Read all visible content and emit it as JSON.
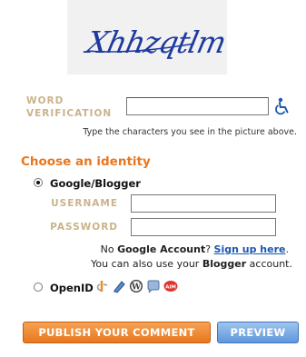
{
  "captcha": {
    "text": "Xhhzqtlm"
  },
  "word_verification": {
    "label": "WORD VERIFICATION",
    "hint": "Type the characters you see in the picture above.",
    "value": ""
  },
  "identity": {
    "title": "Choose an identity",
    "google": {
      "label": "Google/Blogger",
      "selected": true,
      "username_label": "USERNAME",
      "password_label": "PASSWORD",
      "username_value": "",
      "password_value": "",
      "no_account_prefix": "No ",
      "no_account_bold": "Google Account",
      "no_account_suffix": "? ",
      "signup_link": "Sign up here",
      "signup_suffix": ".",
      "also_prefix": "You can also use your ",
      "also_bold": "Blogger",
      "also_suffix": " account."
    },
    "openid": {
      "label": "OpenID",
      "selected": false,
      "providers": [
        "openid-icon",
        "livejournal-icon",
        "wordpress-icon",
        "typepad-icon",
        "aim-icon"
      ]
    }
  },
  "buttons": {
    "publish": "PUBLISH YOUR COMMENT",
    "preview": "PREVIEW"
  },
  "colors": {
    "accent_orange": "#e8771f",
    "label_tan": "#c9b38a",
    "link_blue": "#1a57b0",
    "preview_blue": "#5f97dc"
  }
}
